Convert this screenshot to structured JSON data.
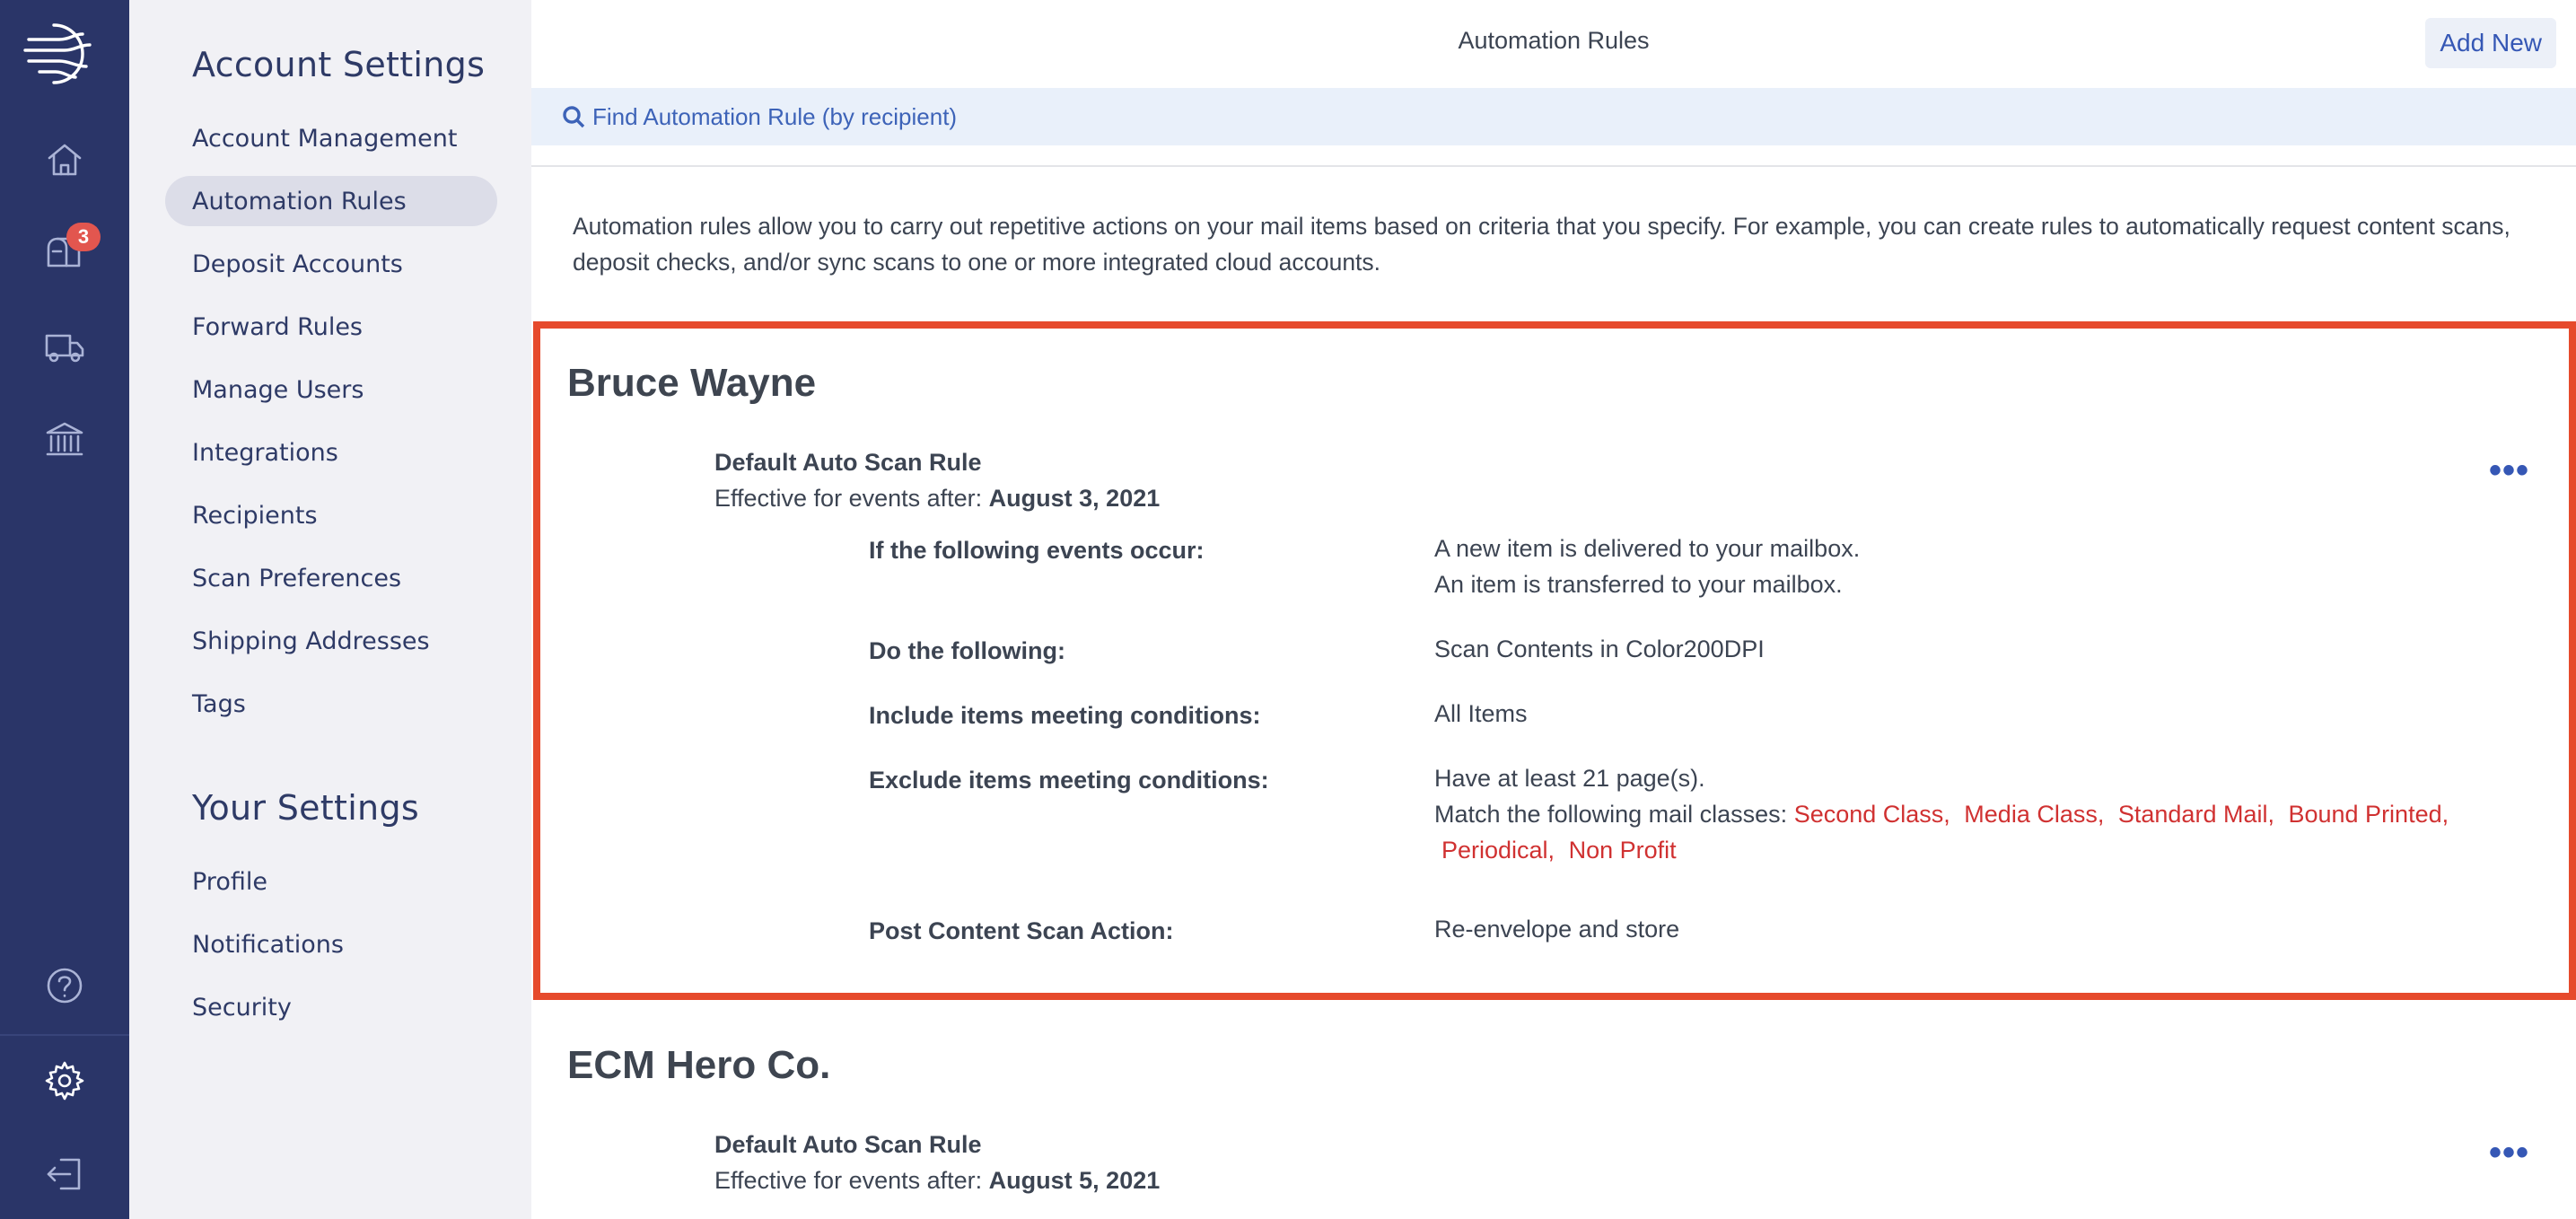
{
  "app": {
    "notifications_badge": "3"
  },
  "nav": {
    "account_heading": "Account Settings",
    "account_items": [
      "Account Management",
      "Automation Rules",
      "Deposit Accounts",
      "Forward Rules",
      "Manage Users",
      "Integrations",
      "Recipients",
      "Scan Preferences",
      "Shipping Addresses",
      "Tags"
    ],
    "your_heading": "Your Settings",
    "your_items": [
      "Profile",
      "Notifications",
      "Security"
    ],
    "active_item": "Automation Rules"
  },
  "header": {
    "title": "Automation Rules",
    "add_new_label": "Add New"
  },
  "search": {
    "label": "Find Automation Rule (by recipient)"
  },
  "intro": "Automation rules allow you to carry out repetitive actions on your mail items based on criteria that you specify. For example, you can create rules to automatically request content scans, deposit checks, and/or sync scans to one or more integrated cloud accounts.",
  "recipients": [
    {
      "name": "Bruce Wayne",
      "rule_name": "Default Auto Scan Rule",
      "effective_prefix": "Effective for events after:",
      "effective_date": "August 3, 2021",
      "more_label": "•••",
      "events_label": "If the following events occur:",
      "events": [
        "A new item is delivered to your mailbox.",
        "An item is transferred to your mailbox."
      ],
      "do_label": "Do the following:",
      "do_value": "Scan Contents in Color200DPI",
      "include_label": "Include items meeting conditions:",
      "include_value": "All Items",
      "exclude_label": "Exclude items meeting conditions:",
      "exclude_pages": "Have at least 21 page(s).",
      "exclude_classes_prefix": "Match the following mail classes:",
      "exclude_classes": [
        "Second Class,",
        "Media Class,",
        "Standard Mail,",
        "Bound Printed,",
        "Periodical,",
        "Non Profit"
      ],
      "post_label": "Post Content Scan Action:",
      "post_value": "Re-envelope and store"
    },
    {
      "name": "ECM Hero Co.",
      "rule_name": "Default Auto Scan Rule",
      "effective_prefix": "Effective for events after:",
      "effective_date": "August 5, 2021",
      "more_label": "•••"
    }
  ],
  "colors": {
    "rail_bg": "#2a3568",
    "nav_bg": "#f1f1f5",
    "accent_blue": "#3557b5",
    "highlight_border": "#e64a2c",
    "mail_class_red": "#d03131",
    "badge_red": "#e2564f"
  }
}
